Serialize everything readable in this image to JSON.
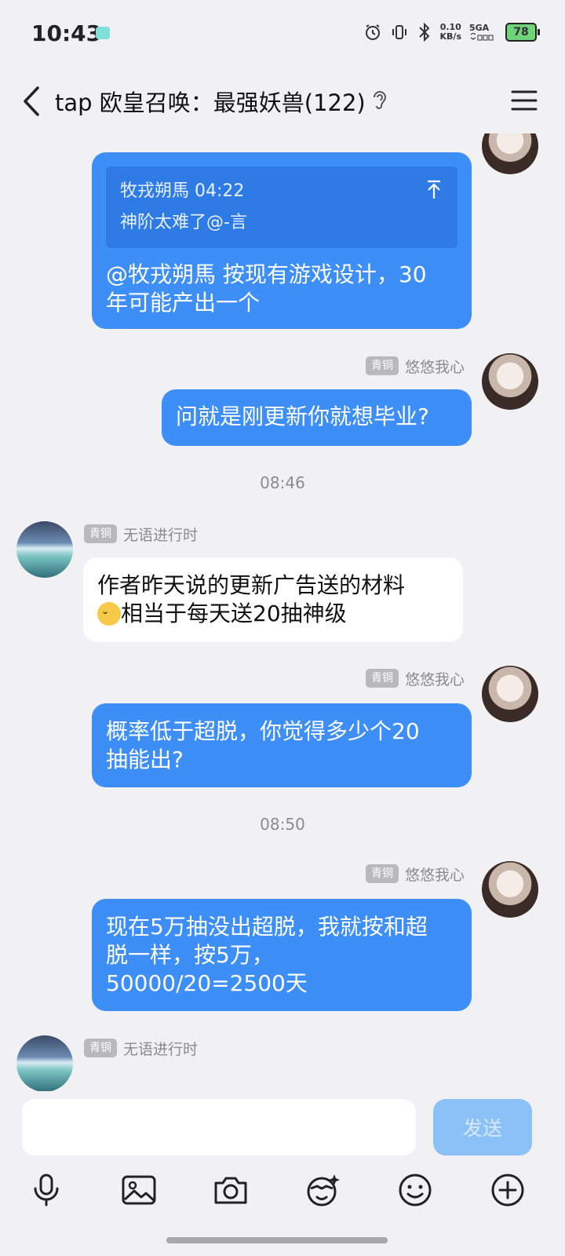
{
  "status": {
    "time": "10:43",
    "net_speed_value": "0.10",
    "net_speed_unit": "KB/s",
    "signal_label": "5GA",
    "battery": "78"
  },
  "header": {
    "title": "tap 欧皇召唤：最强妖兽(122)"
  },
  "messages": {
    "m0": {
      "quote_author_time": "牧戎朔馬 04:22",
      "quote_text": "神阶太难了@-言",
      "text_line1": "@牧戎朔馬 按现有游戏设计，30",
      "text_line2": "年可能产出一个"
    },
    "m1": {
      "badge": "青铜",
      "sender": "悠悠我心",
      "text": "问就是刚更新你就想毕业?"
    },
    "time1": "08:46",
    "m2": {
      "badge": "青铜",
      "sender": "无语进行时",
      "text_line1": "作者昨天说的更新广告送的材料",
      "text_line2_after_emoji": "相当于每天送20抽神级"
    },
    "m3": {
      "badge": "青铜",
      "sender": "悠悠我心",
      "text_line1": "概率低于超脱，你觉得多少个20",
      "text_line2": "抽能出?"
    },
    "time2": "08:50",
    "m4": {
      "badge": "青铜",
      "sender": "悠悠我心",
      "text_line1": "现在5万抽没出超脱，我就按和超",
      "text_line2": "脱一样，按5万，",
      "text_line3": "50000/20=2500天"
    },
    "m5": {
      "badge": "青铜",
      "sender": "无语进行时"
    }
  },
  "input": {
    "value": "",
    "send_label": "发送"
  },
  "icons": {
    "voice": "mic-icon",
    "image": "image-icon",
    "camera": "camera-icon",
    "sticker": "sticker-icon",
    "emoji": "emoji-icon",
    "more": "plus-icon"
  },
  "colors": {
    "my_bubble": "#3d8ef6",
    "other_bubble": "#ffffff",
    "background": "#f1f1f3",
    "send_button_disabled": "#8cc1f7"
  }
}
